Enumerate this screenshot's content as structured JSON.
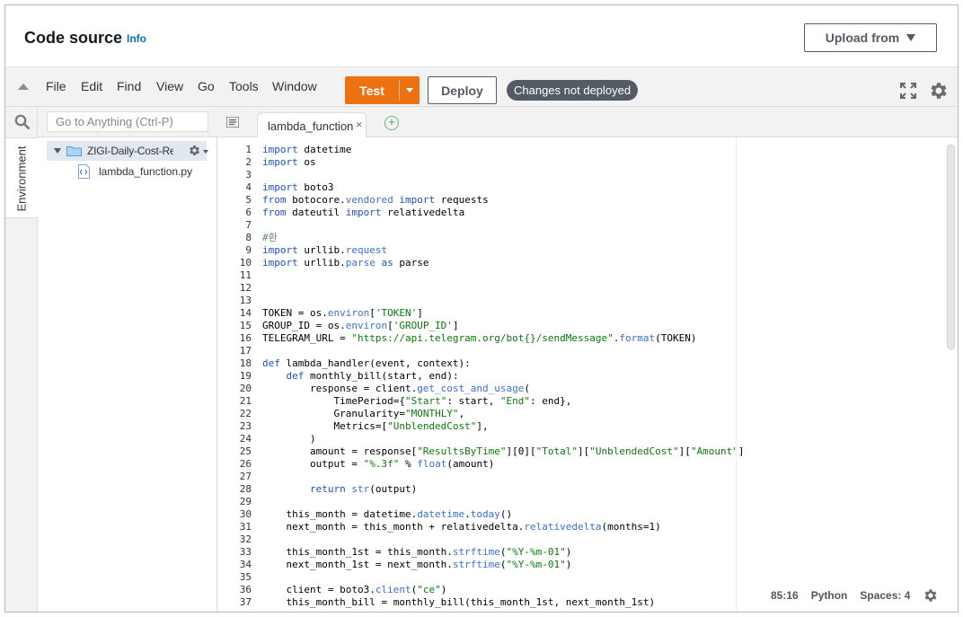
{
  "header": {
    "title": "Code source",
    "info_link": "Info",
    "upload_button": "Upload from"
  },
  "menubar": {
    "items": [
      "File",
      "Edit",
      "Find",
      "View",
      "Go",
      "Tools",
      "Window"
    ],
    "test_button": "Test",
    "deploy_button": "Deploy",
    "status_badge": "Changes not deployed"
  },
  "sidebar": {
    "search_placeholder": "Go to Anything (Ctrl-P)",
    "environment_tab": "Environment",
    "folder_name": "ZIGI-Daily-Cost-Rep",
    "file_name": "lambda_function.py"
  },
  "editor": {
    "tab_label": "lambda_function",
    "close_glyph": "×",
    "new_tab_glyph": "+",
    "lines": [
      "import datetime",
      "import os",
      "",
      "import boto3",
      "from botocore.vendored import requests",
      "from dateutil import relativedelta",
      "",
      "#환",
      "import urllib.request",
      "import urllib.parse as parse",
      "",
      "",
      "",
      "TOKEN = os.environ['TOKEN']",
      "GROUP_ID = os.environ['GROUP_ID']",
      "TELEGRAM_URL = \"https://api.telegram.org/bot{}/sendMessage\".format(TOKEN)",
      "",
      "def lambda_handler(event, context):",
      "    def monthly_bill(start, end):",
      "        response = client.get_cost_and_usage(",
      "            TimePeriod={\"Start\": start, \"End\": end},",
      "            Granularity=\"MONTHLY\",",
      "            Metrics=[\"UnblendedCost\"],",
      "        )",
      "        amount = response[\"ResultsByTime\"][0][\"Total\"][\"UnblendedCost\"][\"Amount\"]",
      "        output = \"%.3f\" % float(amount)",
      "",
      "        return str(output)",
      "",
      "    this_month = datetime.datetime.today()",
      "    next_month = this_month + relativedelta.relativedelta(months=1)",
      "",
      "    this_month_1st = this_month.strftime(\"%Y-%m-01\")",
      "    next_month_1st = next_month.strftime(\"%Y-%m-01\")",
      "",
      "    client = boto3.client(\"ce\")",
      "    this_month_bill = monthly_bill(this_month_1st, next_month_1st)"
    ]
  },
  "statusbar": {
    "cursor": "85:16",
    "language": "Python",
    "indent": "Spaces: 4"
  },
  "icons": {
    "collapse": "collapse-up-icon",
    "fullscreen": "fullscreen-icon",
    "settings": "gear-icon",
    "search": "search-icon",
    "folder": "folder-icon",
    "file": "python-file-icon"
  },
  "colors": {
    "accent": "#ec7211",
    "link": "#0073bb",
    "badge": "#545b64"
  }
}
